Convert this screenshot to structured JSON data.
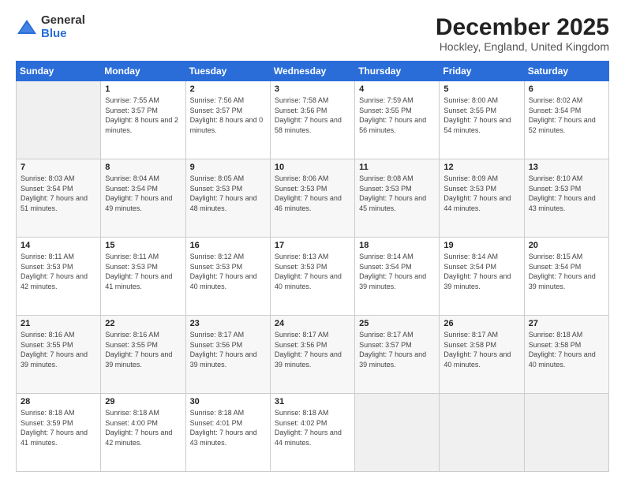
{
  "logo": {
    "general": "General",
    "blue": "Blue"
  },
  "header": {
    "title": "December 2025",
    "subtitle": "Hockley, England, United Kingdom"
  },
  "days_of_week": [
    "Sunday",
    "Monday",
    "Tuesday",
    "Wednesday",
    "Thursday",
    "Friday",
    "Saturday"
  ],
  "weeks": [
    [
      {
        "num": "",
        "sunrise": "",
        "sunset": "",
        "daylight": ""
      },
      {
        "num": "1",
        "sunrise": "Sunrise: 7:55 AM",
        "sunset": "Sunset: 3:57 PM",
        "daylight": "Daylight: 8 hours and 2 minutes."
      },
      {
        "num": "2",
        "sunrise": "Sunrise: 7:56 AM",
        "sunset": "Sunset: 3:57 PM",
        "daylight": "Daylight: 8 hours and 0 minutes."
      },
      {
        "num": "3",
        "sunrise": "Sunrise: 7:58 AM",
        "sunset": "Sunset: 3:56 PM",
        "daylight": "Daylight: 7 hours and 58 minutes."
      },
      {
        "num": "4",
        "sunrise": "Sunrise: 7:59 AM",
        "sunset": "Sunset: 3:55 PM",
        "daylight": "Daylight: 7 hours and 56 minutes."
      },
      {
        "num": "5",
        "sunrise": "Sunrise: 8:00 AM",
        "sunset": "Sunset: 3:55 PM",
        "daylight": "Daylight: 7 hours and 54 minutes."
      },
      {
        "num": "6",
        "sunrise": "Sunrise: 8:02 AM",
        "sunset": "Sunset: 3:54 PM",
        "daylight": "Daylight: 7 hours and 52 minutes."
      }
    ],
    [
      {
        "num": "7",
        "sunrise": "Sunrise: 8:03 AM",
        "sunset": "Sunset: 3:54 PM",
        "daylight": "Daylight: 7 hours and 51 minutes."
      },
      {
        "num": "8",
        "sunrise": "Sunrise: 8:04 AM",
        "sunset": "Sunset: 3:54 PM",
        "daylight": "Daylight: 7 hours and 49 minutes."
      },
      {
        "num": "9",
        "sunrise": "Sunrise: 8:05 AM",
        "sunset": "Sunset: 3:53 PM",
        "daylight": "Daylight: 7 hours and 48 minutes."
      },
      {
        "num": "10",
        "sunrise": "Sunrise: 8:06 AM",
        "sunset": "Sunset: 3:53 PM",
        "daylight": "Daylight: 7 hours and 46 minutes."
      },
      {
        "num": "11",
        "sunrise": "Sunrise: 8:08 AM",
        "sunset": "Sunset: 3:53 PM",
        "daylight": "Daylight: 7 hours and 45 minutes."
      },
      {
        "num": "12",
        "sunrise": "Sunrise: 8:09 AM",
        "sunset": "Sunset: 3:53 PM",
        "daylight": "Daylight: 7 hours and 44 minutes."
      },
      {
        "num": "13",
        "sunrise": "Sunrise: 8:10 AM",
        "sunset": "Sunset: 3:53 PM",
        "daylight": "Daylight: 7 hours and 43 minutes."
      }
    ],
    [
      {
        "num": "14",
        "sunrise": "Sunrise: 8:11 AM",
        "sunset": "Sunset: 3:53 PM",
        "daylight": "Daylight: 7 hours and 42 minutes."
      },
      {
        "num": "15",
        "sunrise": "Sunrise: 8:11 AM",
        "sunset": "Sunset: 3:53 PM",
        "daylight": "Daylight: 7 hours and 41 minutes."
      },
      {
        "num": "16",
        "sunrise": "Sunrise: 8:12 AM",
        "sunset": "Sunset: 3:53 PM",
        "daylight": "Daylight: 7 hours and 40 minutes."
      },
      {
        "num": "17",
        "sunrise": "Sunrise: 8:13 AM",
        "sunset": "Sunset: 3:53 PM",
        "daylight": "Daylight: 7 hours and 40 minutes."
      },
      {
        "num": "18",
        "sunrise": "Sunrise: 8:14 AM",
        "sunset": "Sunset: 3:54 PM",
        "daylight": "Daylight: 7 hours and 39 minutes."
      },
      {
        "num": "19",
        "sunrise": "Sunrise: 8:14 AM",
        "sunset": "Sunset: 3:54 PM",
        "daylight": "Daylight: 7 hours and 39 minutes."
      },
      {
        "num": "20",
        "sunrise": "Sunrise: 8:15 AM",
        "sunset": "Sunset: 3:54 PM",
        "daylight": "Daylight: 7 hours and 39 minutes."
      }
    ],
    [
      {
        "num": "21",
        "sunrise": "Sunrise: 8:16 AM",
        "sunset": "Sunset: 3:55 PM",
        "daylight": "Daylight: 7 hours and 39 minutes."
      },
      {
        "num": "22",
        "sunrise": "Sunrise: 8:16 AM",
        "sunset": "Sunset: 3:55 PM",
        "daylight": "Daylight: 7 hours and 39 minutes."
      },
      {
        "num": "23",
        "sunrise": "Sunrise: 8:17 AM",
        "sunset": "Sunset: 3:56 PM",
        "daylight": "Daylight: 7 hours and 39 minutes."
      },
      {
        "num": "24",
        "sunrise": "Sunrise: 8:17 AM",
        "sunset": "Sunset: 3:56 PM",
        "daylight": "Daylight: 7 hours and 39 minutes."
      },
      {
        "num": "25",
        "sunrise": "Sunrise: 8:17 AM",
        "sunset": "Sunset: 3:57 PM",
        "daylight": "Daylight: 7 hours and 39 minutes."
      },
      {
        "num": "26",
        "sunrise": "Sunrise: 8:17 AM",
        "sunset": "Sunset: 3:58 PM",
        "daylight": "Daylight: 7 hours and 40 minutes."
      },
      {
        "num": "27",
        "sunrise": "Sunrise: 8:18 AM",
        "sunset": "Sunset: 3:58 PM",
        "daylight": "Daylight: 7 hours and 40 minutes."
      }
    ],
    [
      {
        "num": "28",
        "sunrise": "Sunrise: 8:18 AM",
        "sunset": "Sunset: 3:59 PM",
        "daylight": "Daylight: 7 hours and 41 minutes."
      },
      {
        "num": "29",
        "sunrise": "Sunrise: 8:18 AM",
        "sunset": "Sunset: 4:00 PM",
        "daylight": "Daylight: 7 hours and 42 minutes."
      },
      {
        "num": "30",
        "sunrise": "Sunrise: 8:18 AM",
        "sunset": "Sunset: 4:01 PM",
        "daylight": "Daylight: 7 hours and 43 minutes."
      },
      {
        "num": "31",
        "sunrise": "Sunrise: 8:18 AM",
        "sunset": "Sunset: 4:02 PM",
        "daylight": "Daylight: 7 hours and 44 minutes."
      },
      {
        "num": "",
        "sunrise": "",
        "sunset": "",
        "daylight": ""
      },
      {
        "num": "",
        "sunrise": "",
        "sunset": "",
        "daylight": ""
      },
      {
        "num": "",
        "sunrise": "",
        "sunset": "",
        "daylight": ""
      }
    ]
  ]
}
